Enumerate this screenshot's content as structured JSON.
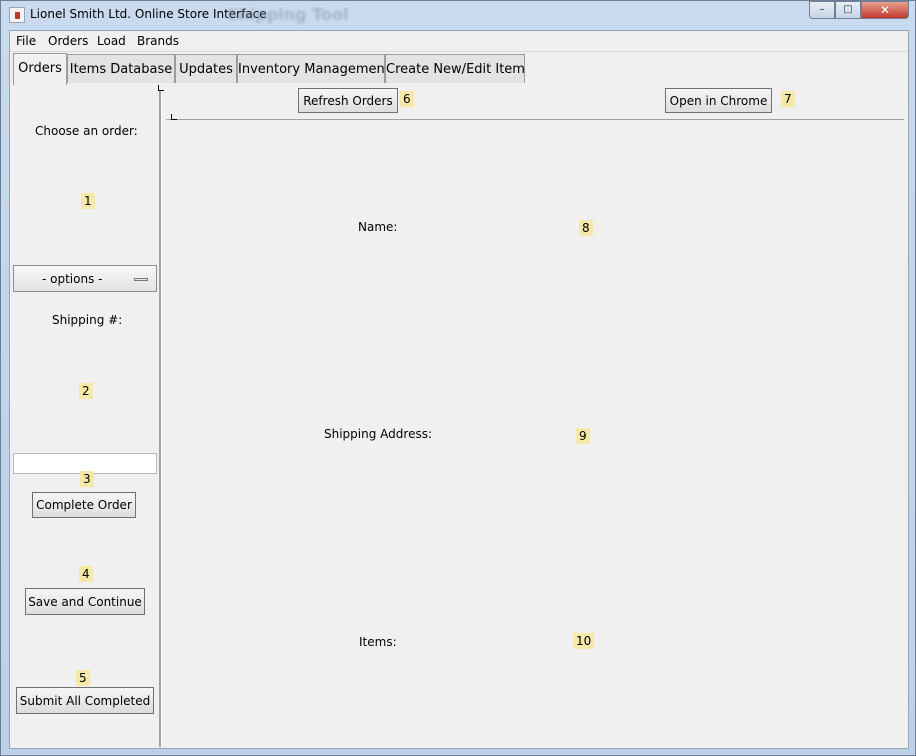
{
  "window": {
    "title": "Lionel Smith Ltd. Online Store Interface",
    "ghost_title": "Shipping Tool",
    "minimize_glyph": "–",
    "maximize_glyph": "□",
    "close_glyph": "✕"
  },
  "menubar": {
    "items": [
      {
        "label": "File"
      },
      {
        "label": "Orders"
      },
      {
        "label": "Load"
      },
      {
        "label": "Brands"
      }
    ]
  },
  "tabs": [
    {
      "label": "Orders",
      "active": true
    },
    {
      "label": "Items Database",
      "active": false
    },
    {
      "label": "Updates",
      "active": false
    },
    {
      "label": "Inventory Management",
      "active": false
    },
    {
      "label": "Create New/Edit Item",
      "active": false
    }
  ],
  "left_panel": {
    "choose_order_label": "Choose an order:",
    "order_select_value": "- options -",
    "shipping_label": "Shipping #:",
    "shipping_value": "",
    "complete_order_button": "Complete Order",
    "save_continue_button": "Save and Continue",
    "submit_all_button": "Submit All Completed"
  },
  "main_panel": {
    "refresh_orders_button": "Refresh Orders",
    "open_chrome_button": "Open in Chrome",
    "name_label": "Name:",
    "shipping_address_label": "Shipping Address:",
    "items_label": "Items:"
  },
  "annotations": {
    "n1": "1",
    "n2": "2",
    "n3": "3",
    "n4": "4",
    "n5": "5",
    "n6": "6",
    "n7": "7",
    "n8": "8",
    "n9": "9",
    "n10": "10"
  },
  "colors": {
    "badge": "#f6e8a8",
    "panel": "#f0f0f0",
    "titlebar": "#c9daee",
    "close_button": "#c0392b"
  }
}
